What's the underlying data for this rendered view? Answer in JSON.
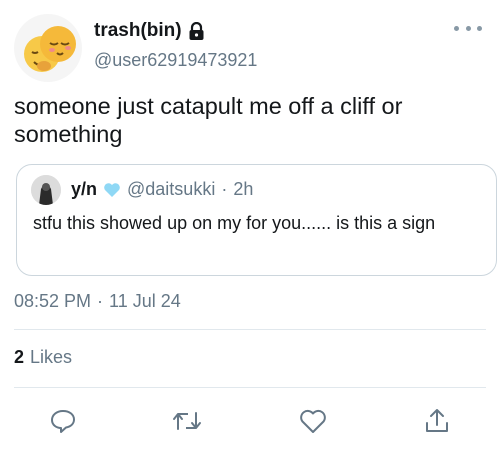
{
  "author": {
    "display_name": "trash(bin)",
    "handle": "@user62919473921",
    "avatar": "emoji-avatar",
    "protected_icon": "lock-icon"
  },
  "tweet": {
    "text": "someone just catapult me off a cliff or something"
  },
  "quoted_tweet": {
    "display_name": "y/n",
    "verified_icon": "blue-heart-icon",
    "handle": "@daitsukki",
    "separator": "·",
    "time": "2h",
    "text": "stfu this showed up on my for you...... is this a sign"
  },
  "meta": {
    "time": "08:52 PM",
    "separator": "·",
    "date": "11 Jul 24"
  },
  "engagement": {
    "likes_count": "2",
    "likes_label": "Likes"
  },
  "actions": [
    "reply-icon",
    "retweet-icon",
    "like-icon",
    "share-icon"
  ],
  "colors": {
    "secondary_text": "#657786",
    "divider": "#e1e8ed",
    "accent": "#1da1f2"
  }
}
